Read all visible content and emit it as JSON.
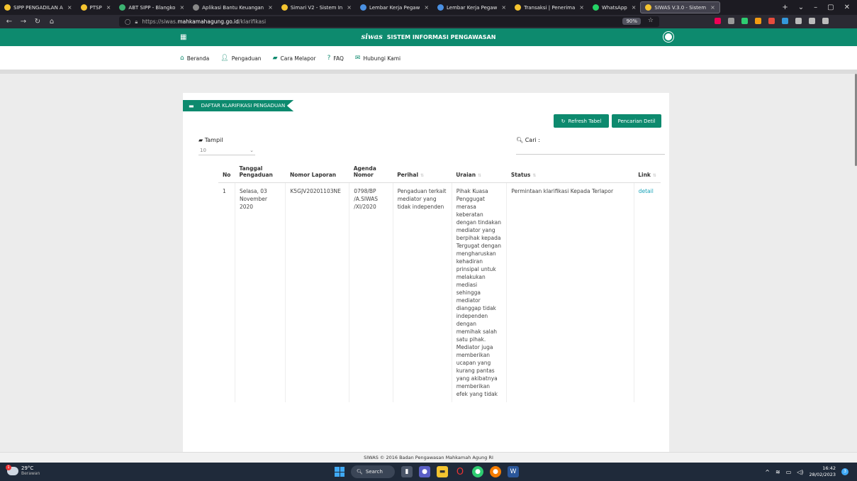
{
  "browser": {
    "tabs": [
      {
        "title": "SIPP PENGADILAN A",
        "color": "#f4c430"
      },
      {
        "title": "PTSP",
        "color": "#f4c430"
      },
      {
        "title": "ABT SIPP - Blangko",
        "color": "#3cb371"
      },
      {
        "title": "Aplikasi Bantu Keuangan",
        "color": "#888888"
      },
      {
        "title": "Simari V2 - Sistem In",
        "color": "#f4c430"
      },
      {
        "title": "Lembar Kerja Pegaw",
        "color": "#4a90e2"
      },
      {
        "title": "Lembar Kerja Pegaw",
        "color": "#4a90e2"
      },
      {
        "title": "Transaksi | Penerima",
        "color": "#f4c430"
      },
      {
        "title": "WhatsApp",
        "color": "#25d366"
      },
      {
        "title": "SIWAS V.3.0 - Sistem",
        "color": "#f4c430"
      }
    ],
    "url_prefix": "https://siwas.",
    "url_host": "mahkamahagung.go.id",
    "url_path": "/klarifikasi",
    "zoom": "90%"
  },
  "header": {
    "logo": "siwas",
    "title": "SISTEM INFORMASI PENGAWASAN"
  },
  "nav": [
    {
      "label": "Beranda",
      "icon": "home-icon"
    },
    {
      "label": "Pengaduan",
      "icon": "user-add-icon"
    },
    {
      "label": "Cara Melapor",
      "icon": "book-icon"
    },
    {
      "label": "FAQ",
      "icon": "question-icon"
    },
    {
      "label": "Hubungi Kami",
      "icon": "mail-icon"
    }
  ],
  "panel": {
    "title": "DAFTAR KLARIFIKASI PENGADUAN",
    "refresh_label": "Refresh Tabel",
    "search_detail_label": "Pencarian Detil",
    "show_label": "Tampil",
    "show_value": "10",
    "search_label": "Cari :"
  },
  "table": {
    "headers": [
      "No",
      "Tanggal Pengaduan",
      "Nomor Laporan",
      "Agenda Nomor",
      "Perihal",
      "Uraian",
      "Status",
      "Link"
    ],
    "rows": [
      {
        "no": "1",
        "tanggal": "Selasa, 03 November 2020",
        "nomor": "K5GJV20201103NE",
        "agenda": "0798/BP /A.SIWAS /XI/2020",
        "perihal": "Pengaduan terkait mediator yang tidak independen",
        "uraian": "Pihak Kuasa Penggugat merasa keberatan dengan tindakan mediator yang berpihak kepada Tergugat dengan mengharuskan kehadiran prinsipal untuk melakukan mediasi sehingga mediator dianggap tidak independen dengan memihak salah satu pihak. Mediator juga memberikan ucapan yang kurang pantas yang akibatnya memberikan efek yang tidak",
        "status": "Permintaan klarifikasi Kepada Terlapor",
        "link": "detail"
      }
    ]
  },
  "footer": "SIWAS © 2016 Badan Pengawasan Mahkamah Agung RI",
  "taskbar": {
    "temp": "29°C",
    "weather": "Berawan",
    "weather_badge": "1",
    "search": "Search",
    "time": "16:42",
    "date": "28/02/2023",
    "notif": "3"
  },
  "colors": {
    "primary": "#0d8a6e",
    "link": "#17a2b8"
  }
}
